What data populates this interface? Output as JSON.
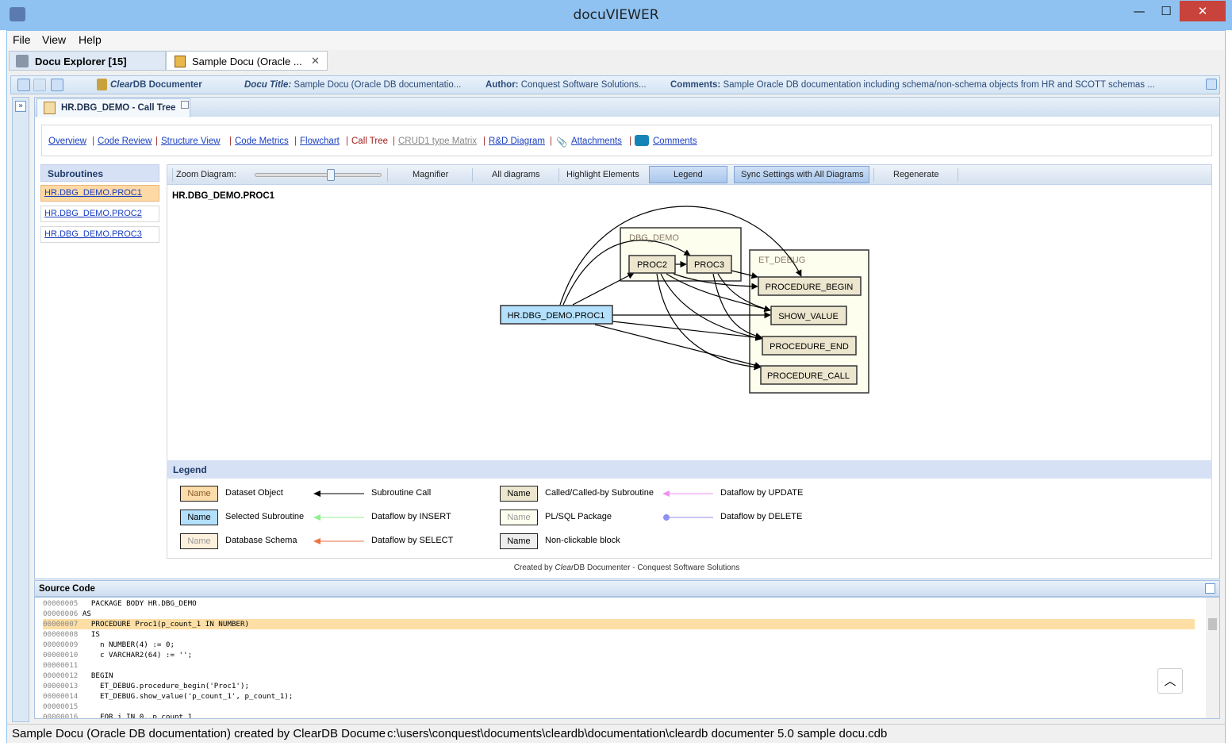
{
  "window": {
    "title": "docuVIEWER",
    "minimize": "—",
    "maximize": "☐",
    "close": "✕"
  },
  "menu": [
    "File",
    "View",
    "Help"
  ],
  "tabs": [
    {
      "label": "Docu Explorer [15]"
    },
    {
      "label": "Sample Docu (Oracle ...",
      "close": "✕"
    }
  ],
  "infobar": {
    "brand_italic": "Clear",
    "brand_rest": "DB Documenter",
    "docu_title_label": "Docu Title:",
    "docu_title": "Sample Docu (Oracle DB documentatio...",
    "author_label": "Author:",
    "author": "Conquest Software Solutions...",
    "comments_label": "Comments:",
    "comments": "Sample Oracle DB documentation including schema/non-schema objects from HR and SCOTT schemas ..."
  },
  "content_tab": {
    "label": "HR.DBG_DEMO - Call Tree"
  },
  "nav": [
    "Overview",
    "Code Review",
    "Structure View",
    "Code Metrics",
    "Flowchart",
    "Call Tree",
    "CRUD1 type Matrix",
    "R&D Diagram",
    "Attachments",
    "Comments"
  ],
  "nav_active": "Call Tree",
  "subroutines": {
    "header": "Subroutines",
    "items": [
      "HR.DBG_DEMO.PROC1",
      "HR.DBG_DEMO.PROC2",
      "HR.DBG_DEMO.PROC3"
    ],
    "selected": 0
  },
  "toolbar": {
    "zoom_label": "Zoom Diagram:",
    "zoom_level": 0.6,
    "magnifier": "Magnifier",
    "all_diagrams": "All diagrams",
    "highlight": "Highlight Elements",
    "legend": "Legend",
    "sync": "Sync Settings with All Diagrams",
    "regenerate": "Regenerate"
  },
  "diagram": {
    "title": "HR.DBG_DEMO.PROC1",
    "clusters": [
      "DBG_DEMO",
      "ET_DEBUG"
    ],
    "nodes": {
      "proc1": "HR.DBG_DEMO.PROC1",
      "proc2": "PROC2",
      "proc3": "PROC3",
      "begin": "PROCEDURE_BEGIN",
      "show": "SHOW_VALUE",
      "end": "PROCEDURE_END",
      "call": "PROCEDURE_CALL"
    },
    "colors": {
      "selected": "#b3e0fc",
      "called": "#ede6cf",
      "package": "#fefeef"
    }
  },
  "legend": {
    "header": "Legend",
    "items": [
      {
        "swatch": "Name",
        "label": "Dataset Object",
        "color": "#fcdcaa"
      },
      {
        "swatch": "Name",
        "label": "Selected Subroutine",
        "color": "#b3e0fc"
      },
      {
        "swatch": "Name",
        "label": "Database Schema",
        "color": "#fdf0dc"
      },
      {
        "label": "Subroutine Call",
        "color": "#000000"
      },
      {
        "label": "Dataflow by INSERT",
        "color": "#90f090"
      },
      {
        "label": "Dataflow by SELECT",
        "color": "#f07040"
      },
      {
        "swatch": "Name",
        "label": "Called/Called-by Subroutine",
        "color": "#ede6cf"
      },
      {
        "swatch": "Name",
        "label": "PL/SQL Package",
        "color": "#fefeef"
      },
      {
        "swatch": "Name",
        "label": "Non-clickable block",
        "color": "#eeeeee"
      },
      {
        "label": "Dataflow by UPDATE",
        "color": "#f090f0"
      },
      {
        "label": "Dataflow by DELETE",
        "color": "#9090f0"
      }
    ]
  },
  "created_by": {
    "pre": "Created by ",
    "brand_italic": "Clear",
    "rest": "DB Documenter - Conquest Software Solutions"
  },
  "source": {
    "header": "Source Code",
    "lines": [
      {
        "no": "00000005",
        "code": "  PACKAGE BODY HR.DBG_DEMO"
      },
      {
        "no": "00000006",
        "code": "AS"
      },
      {
        "no": "00000007",
        "code": "  PROCEDURE Proc1(p_count_1 IN NUMBER)",
        "highlight": true
      },
      {
        "no": "00000008",
        "code": "  IS"
      },
      {
        "no": "00000009",
        "code": "    n NUMBER(4) := 0;"
      },
      {
        "no": "00000010",
        "code": "    c VARCHAR2(64) := '';"
      },
      {
        "no": "00000011",
        "code": ""
      },
      {
        "no": "00000012",
        "code": "  BEGIN"
      },
      {
        "no": "00000013",
        "code": "    ET_DEBUG.procedure_begin('Proc1');"
      },
      {
        "no": "00000014",
        "code": "    ET_DEBUG.show_value('p_count_1', p_count_1);"
      },
      {
        "no": "00000015",
        "code": ""
      },
      {
        "no": "00000016",
        "code": "    FOR i IN 0..p_count_1"
      }
    ]
  },
  "status": {
    "left": "Sample Docu (Oracle DB documentation) created by ClearDB Docume",
    "right": "c:\\users\\conquest\\documents\\cleardb\\documentation\\cleardb documenter 5.0 sample docu.cdb"
  }
}
